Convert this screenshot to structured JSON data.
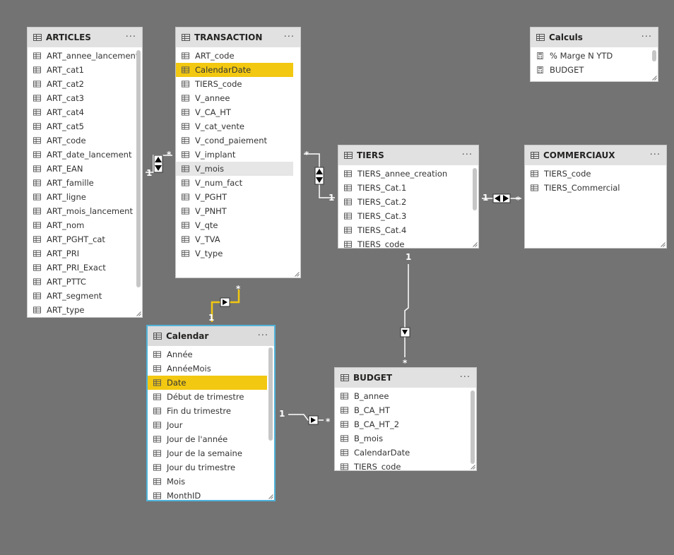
{
  "colors": {
    "background": "#737373",
    "highlight": "#f2c811",
    "selected_border": "#4fb3d9",
    "header": "#e1e1e1"
  },
  "icons": {
    "table": "table-grid-icon",
    "column": "column-grid-icon",
    "measure": "calculator-icon",
    "menu": "more-options-icon"
  },
  "tables": {
    "articles": {
      "title": "ARTICLES",
      "menu": "···",
      "columns": [
        "ART_annee_lancement",
        "ART_cat1",
        "ART_cat2",
        "ART_cat3",
        "ART_cat4",
        "ART_cat5",
        "ART_code",
        "ART_date_lancement",
        "ART_EAN",
        "ART_famille",
        "ART_ligne",
        "ART_mois_lancement",
        "ART_nom",
        "ART_PGHT_cat",
        "ART_PRI",
        "ART_PRI_Exact",
        "ART_PTTC",
        "ART_segment",
        "ART_type"
      ]
    },
    "transaction": {
      "title": "TRANSACTION",
      "menu": "···",
      "columns": [
        "ART_code",
        "CalendarDate",
        "TIERS_code",
        "V_annee",
        "V_CA_HT",
        "V_cat_vente",
        "V_cond_paiement",
        "V_implant",
        "V_mois",
        "V_num_fact",
        "V_PGHT",
        "V_PNHT",
        "V_qte",
        "V_TVA",
        "V_type"
      ]
    },
    "calculs": {
      "title": "Calculs",
      "menu": "···",
      "columns": [
        "% Marge N YTD",
        "BUDGET"
      ]
    },
    "tiers": {
      "title": "TIERS",
      "menu": "···",
      "columns": [
        "TIERS_annee_creation",
        "TIERS_Cat.1",
        "TIERS_Cat.2",
        "TIERS_Cat.3",
        "TIERS_Cat.4",
        "TIERS_code"
      ]
    },
    "commerciaux": {
      "title": "COMMERCIAUX",
      "menu": "···",
      "columns": [
        "TIERS_code",
        "TIERS_Commercial"
      ]
    },
    "calendar": {
      "title": "Calendar",
      "menu": "···",
      "columns": [
        "Année",
        "AnnéeMois",
        "Date",
        "Début de trimestre",
        "Fin du trimestre",
        "Jour",
        "Jour de l'année",
        "Jour de la semaine",
        "Jour du trimestre",
        "Mois",
        "MonthID"
      ]
    },
    "budget": {
      "title": "BUDGET",
      "menu": "···",
      "columns": [
        "B_annee",
        "B_CA_HT",
        "B_CA_HT_2",
        "B_mois",
        "CalendarDate",
        "TIERS_code"
      ]
    }
  },
  "relationships": {
    "articles_transaction": {
      "from_card": "1",
      "to_card": "*"
    },
    "transaction_tiers": {
      "from_card": "*",
      "to_card": "1"
    },
    "tiers_commerciaux": {
      "from_card": "1",
      "to_card": "*"
    },
    "transaction_calendar": {
      "from_card": "*",
      "to_card": "1"
    },
    "tiers_budget": {
      "from_card": "1",
      "to_card": "*"
    },
    "calendar_budget": {
      "from_card": "1",
      "to_card": "*"
    }
  }
}
